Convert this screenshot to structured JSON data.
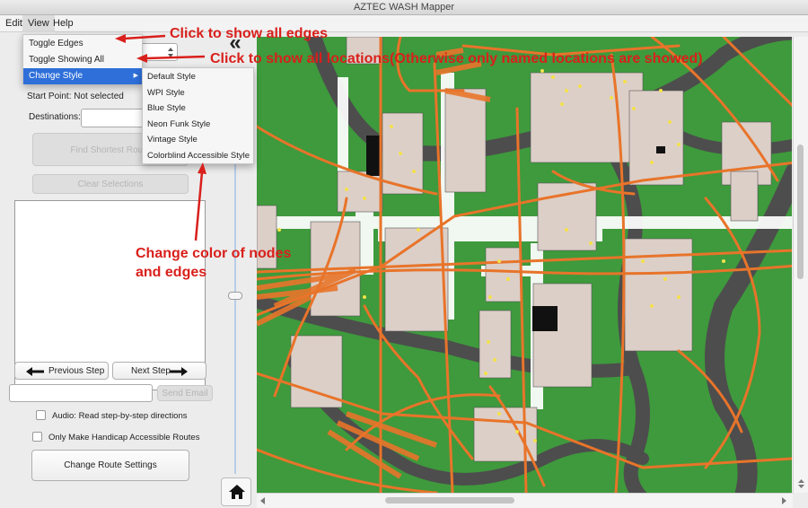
{
  "window": {
    "title": "AZTEC WASH Mapper"
  },
  "menubar": {
    "edit": "Edit",
    "view": "View",
    "help": "Help"
  },
  "view_menu": {
    "items": [
      "Toggle Edges",
      "Toggle Showing All Locations",
      "Change Style"
    ],
    "submenu_arrow": "▶",
    "style_submenu": [
      "Default Style",
      "WPI Style",
      "Blue Style",
      "Neon Funk Style",
      "Vintage Style",
      "Colorblind Accessible Style"
    ]
  },
  "panel": {
    "collapse_symbol": "«",
    "start_point": "Start Point: Not selected",
    "destinations_label": "Destinations:",
    "find_button": "Find Shortest Route",
    "clear_button": "Clear Selections",
    "prev_button": "Previous Step",
    "next_button": "Next Step",
    "email_value": "",
    "send_email_button": "Send Email",
    "audio_label": "Audio: Read step-by-step directions",
    "handicap_label": "Only Make Handicap Accessible Routes",
    "route_settings_button": "Change Route Settings"
  },
  "annotations": {
    "edges": "Click to show all edges",
    "locations": "Click to show all locations(Otherwise only named locations are showed)",
    "style": [
      "Change color of nodes",
      "and edges"
    ]
  },
  "colors": {
    "grass": "#3e9a3c",
    "road": "#4d4d4d",
    "path": "#e8742a",
    "building": "#dccfc8",
    "annotation": "#d9201c",
    "highlight": "#2e6fd9"
  },
  "icons": {
    "home": "home-icon",
    "prev": "arrow-left-icon",
    "next": "arrow-right-icon"
  }
}
